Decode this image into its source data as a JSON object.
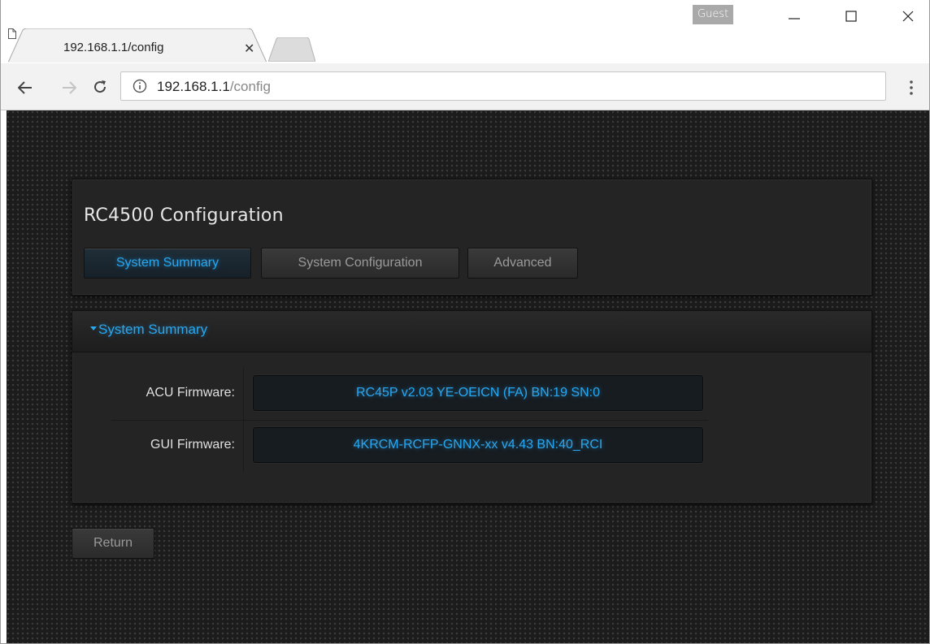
{
  "browser": {
    "profile_label": "Guest",
    "tab_title": "192.168.1.1/config",
    "url_host": "192.168.1.1",
    "url_path": "/config",
    "icons": {
      "minimize": "minimize-icon",
      "maximize": "maximize-icon",
      "close": "close-icon",
      "back": "back-arrow-icon",
      "forward": "forward-arrow-icon",
      "reload": "reload-icon",
      "info": "info-icon",
      "menu": "menu-dots-icon",
      "page": "document-icon"
    }
  },
  "config": {
    "title": "RC4500 Configuration",
    "tabs": [
      {
        "label": "System Summary",
        "active": true
      },
      {
        "label": "System Configuration",
        "active": false
      },
      {
        "label": "Advanced",
        "active": false
      }
    ]
  },
  "summary": {
    "header": "System Summary",
    "rows": [
      {
        "label": "ACU Firmware:",
        "value": "RC45P v2.03 YE-OEICN (FA) BN:19 SN:0"
      },
      {
        "label": "GUI Firmware:",
        "value": "4KRCM-RCFP-GNNX-xx v4.43 BN:40_RCI"
      }
    ]
  },
  "actions": {
    "return_label": "Return"
  },
  "colors": {
    "accent": "#27a8f0",
    "page_bg": "#1c1c1c",
    "panel_bg": "#242424"
  }
}
